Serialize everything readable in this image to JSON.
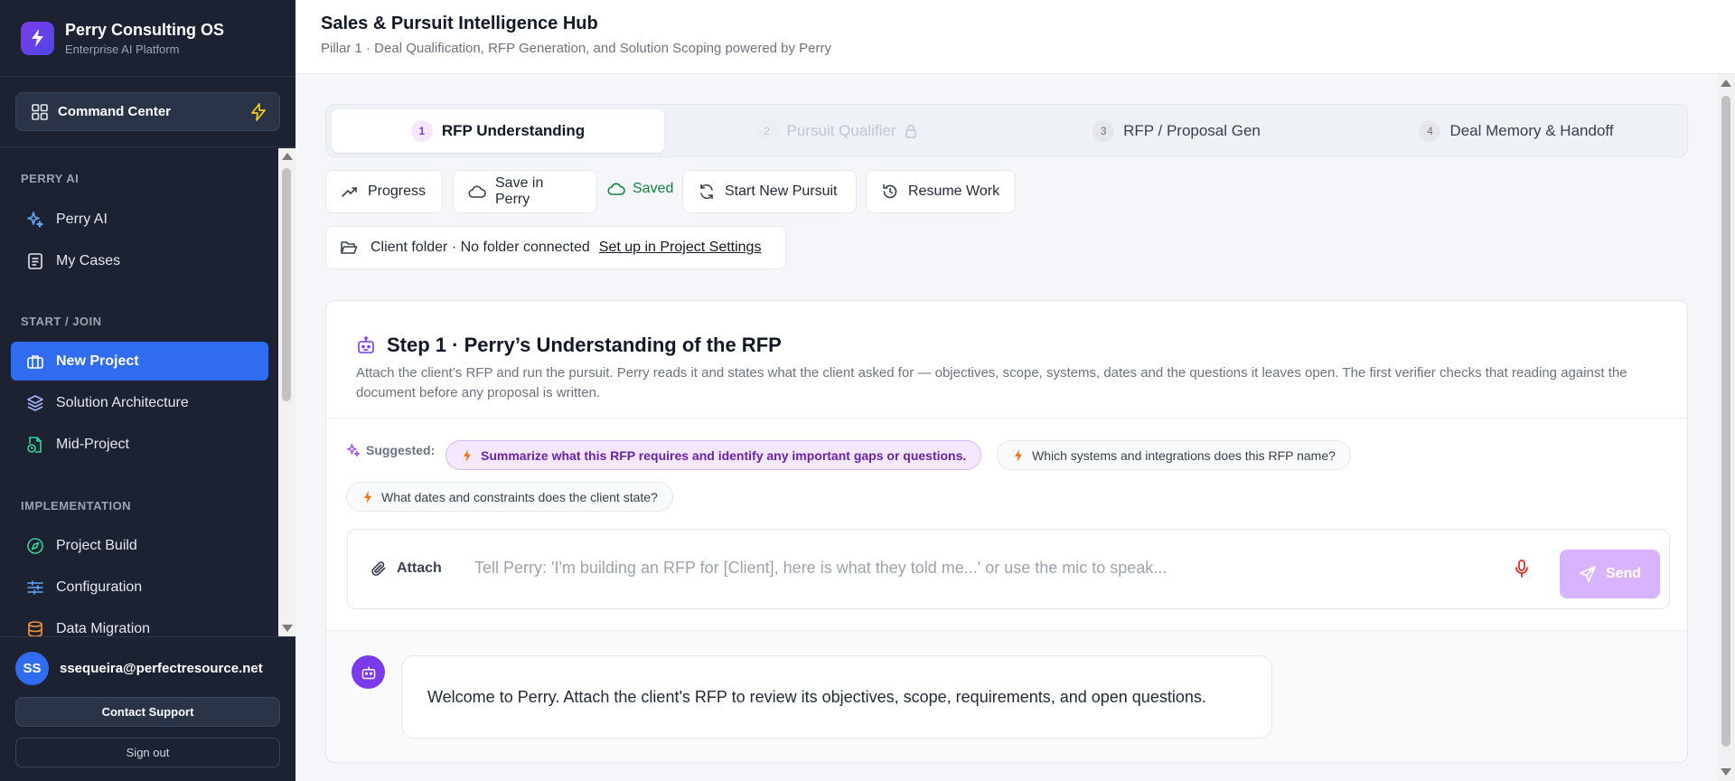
{
  "brand": {
    "title": "Perry Consulting OS",
    "subtitle": "Enterprise AI Platform"
  },
  "sidebar": {
    "command_center": "Command Center",
    "sections": [
      {
        "label": "PERRY AI"
      },
      {
        "label": "START / JOIN"
      },
      {
        "label": "IMPLEMENTATION"
      }
    ],
    "items": [
      {
        "label": "Perry AI",
        "icon": "sparkles-icon"
      },
      {
        "label": "My Cases",
        "icon": "document-icon"
      },
      {
        "label": "New Project",
        "icon": "briefcase-icon",
        "active": true
      },
      {
        "label": "Solution Architecture",
        "icon": "layers-icon"
      },
      {
        "label": "Mid-Project",
        "icon": "file-clock-icon"
      },
      {
        "label": "Project Build",
        "icon": "compass-icon"
      },
      {
        "label": "Configuration",
        "icon": "sliders-icon"
      },
      {
        "label": "Data Migration",
        "icon": "database-icon"
      }
    ]
  },
  "user": {
    "initials": "SS",
    "email": "ssequeira@perfectresource.net",
    "contact_support": "Contact Support",
    "sign_out": "Sign out"
  },
  "header": {
    "title": "Sales & Pursuit Intelligence Hub",
    "subtitle": "Pillar 1 · Deal Qualification, RFP Generation, and Solution Scoping powered by Perry"
  },
  "tabs": [
    {
      "num": "1",
      "label": "RFP Understanding",
      "state": "active"
    },
    {
      "num": "2",
      "label": "Pursuit Qualifier",
      "state": "locked"
    },
    {
      "num": "3",
      "label": "RFP / Proposal Gen",
      "state": "default"
    },
    {
      "num": "4",
      "label": "Deal Memory & Handoff",
      "state": "default"
    }
  ],
  "toolbar": {
    "progress": "Progress",
    "save": "Save in Perry",
    "saved": "Saved",
    "start_new": "Start New Pursuit",
    "resume": "Resume Work"
  },
  "folder": {
    "status": "Client folder · No folder connected",
    "link": "Set up in Project Settings"
  },
  "step": {
    "title": "Step 1 · Perry’s Understanding of the RFP",
    "description": "Attach the client’s RFP and run the pursuit. Perry reads it and states what the client asked for — objectives, scope, systems, dates and the questions it leaves open. The first verifier checks that reading against the document before any proposal is written."
  },
  "suggestions": {
    "label": "Suggested:",
    "items": [
      "Summarize what this RFP requires and identify any important gaps or questions.",
      "Which systems and integrations does this RFP name?",
      "What dates and constraints does the client state?"
    ]
  },
  "composer": {
    "attach": "Attach",
    "placeholder": "Tell Perry: 'I'm building an RFP for [Client], here is what they told me...' or use the mic to speak...",
    "send": "Send"
  },
  "messages": [
    {
      "text": "Welcome to Perry. Attach the client's RFP to review its objectives, scope, requirements, and open questions."
    }
  ],
  "colors": {
    "accent": "#7c3aed",
    "active_nav": "#2f6cf0",
    "saved": "#15803d",
    "sidebar_bg": "#1c2232"
  }
}
